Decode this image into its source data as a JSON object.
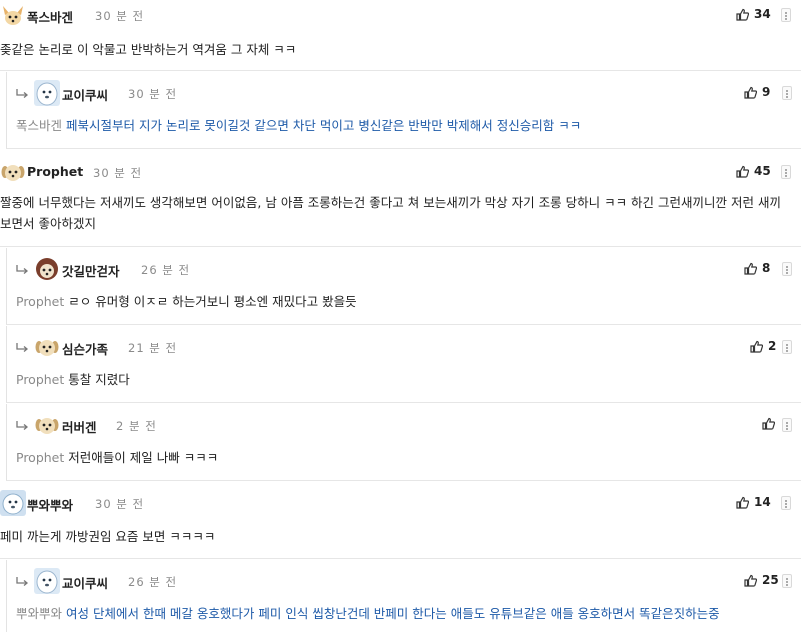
{
  "comments": [
    {
      "nick": "폭스바겐",
      "time": "30 분 전",
      "likes": "34",
      "text": "좆같은 논리로 이 악물고 반박하는거 역겨움 그 자체 ㅋㅋ",
      "avatar": "fox"
    },
    {
      "nick": "교이쿠씨",
      "time": "30 분 전",
      "likes": "9",
      "mention": "폭스바겐",
      "text": "페북시절부터 지가 논리로 못이길것 같으면 차단 먹이고 병신같은 반박만 박제해서 정신승리함 ㅋㅋ",
      "avatar": "white"
    },
    {
      "nick": "Prophet",
      "time": "30 분 전",
      "likes": "45",
      "text": "짤중에 너무했다는 저새끼도 생각해보면 어이없음, 남 아픔 조롱하는건 좋다고 쳐 보는새끼가 막상 자기 조롱 당하니 ㅋㅋ 하긴 그런새끼니깐 저런 새끼 보면서 좋아하겠지",
      "avatar": "dog"
    },
    {
      "nick": "갓길만걷자",
      "time": "26 분 전",
      "likes": "8",
      "mention": "Prophet",
      "text": "ㄹㅇ 유머형 이ㅈㄹ 하는거보니 평소엔 재밌다고 봤을듯",
      "avatar": "dog2"
    },
    {
      "nick": "심슨가족",
      "time": "21 분 전",
      "likes": "2",
      "mention": "Prophet",
      "text": "통찰 지렸다",
      "avatar": "dog"
    },
    {
      "nick": "러버겐",
      "time": "2 분 전",
      "likes": "",
      "mention": "Prophet",
      "text": "저런애들이 제일 나빠 ㅋㅋㅋ",
      "avatar": "dog"
    },
    {
      "nick": "뿌와뿌와",
      "time": "30 분 전",
      "likes": "14",
      "text": "페미 까는게 까방권임 요즘 보면 ㅋㅋㅋㅋ",
      "avatar": "white2"
    },
    {
      "nick": "교이쿠씨",
      "time": "26 분 전",
      "likes": "25",
      "mention": "뿌와뿌와",
      "text": "여성 단체에서 한때 메갈 옹호했다가 페미 인식 씹창난건데 반페미 한다는 애들도 유튜브같은 애들 옹호하면서 똑같은짓하는중",
      "avatar": "white"
    }
  ],
  "icons": {
    "like": "thumbs-up-icon",
    "reply": "reply-arrow-icon",
    "menu": "kebab-menu-icon"
  },
  "colors": {
    "mention_link": "#1e5aa8",
    "mention_name": "#8a8a8a",
    "time": "#8b8b8b"
  }
}
